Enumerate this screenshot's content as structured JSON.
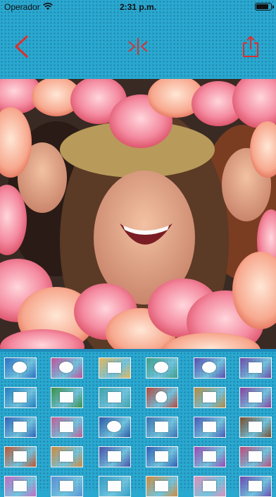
{
  "status_bar": {
    "carrier": "Operador",
    "time": "2:31 p.m.",
    "battery_level": 0.9
  },
  "toolbar": {
    "back_icon": "back-chevron-icon",
    "flip_icon": "flip-horizontal-icon",
    "share_icon": "share-icon",
    "accent_color": "#d8322f"
  },
  "background_color": "#2aa8d0",
  "frames": {
    "thumbnails": [
      {
        "bg": "#2b6fc4",
        "hole": "round"
      },
      {
        "bg": "#c44f9a",
        "hole": "oval"
      },
      {
        "bg": "#e3b75c",
        "hole": "rect"
      },
      {
        "bg": "#3d9f87",
        "hole": "oval"
      },
      {
        "bg": "#5a4bb0",
        "hole": "oval"
      },
      {
        "bg": "#6d4aa6",
        "hole": "rect"
      },
      {
        "bg": "#1f7dbf",
        "hole": "rect"
      },
      {
        "bg": "#3a8f45",
        "hole": "rect"
      },
      {
        "bg": "#3fa2a9",
        "hole": "rect"
      },
      {
        "bg": "#b7473b",
        "hole": "heart"
      },
      {
        "bg": "#b48a3f",
        "hole": "rect"
      },
      {
        "bg": "#8a3e9e",
        "hole": "rect"
      },
      {
        "bg": "#3062b8",
        "hole": "rect"
      },
      {
        "bg": "#c45b93",
        "hole": "rect"
      },
      {
        "bg": "#2c59a6",
        "hole": "oval"
      },
      {
        "bg": "#3b6fb0",
        "hole": "rect"
      },
      {
        "bg": "#4a58b6",
        "hole": "rect"
      },
      {
        "bg": "#7a4a2a",
        "hole": "rect"
      },
      {
        "bg": "#c0542e",
        "hole": "rect"
      },
      {
        "bg": "#d4893a",
        "hole": "rect"
      },
      {
        "bg": "#4c4fa8",
        "hole": "rect"
      },
      {
        "bg": "#2f5fb6",
        "hole": "rect"
      },
      {
        "bg": "#9a47b3",
        "hole": "rect"
      },
      {
        "bg": "#c04878",
        "hole": "rect"
      },
      {
        "bg": "#c46ac2",
        "hole": "rect"
      },
      {
        "bg": "#5b8fd3",
        "hole": "rect"
      },
      {
        "bg": "#2f9cc4",
        "hole": "rect"
      },
      {
        "bg": "#d38a3a",
        "hole": "rect"
      },
      {
        "bg": "#e08fb9",
        "hole": "rect"
      },
      {
        "bg": "#6a49b0",
        "hole": "rect"
      }
    ]
  }
}
